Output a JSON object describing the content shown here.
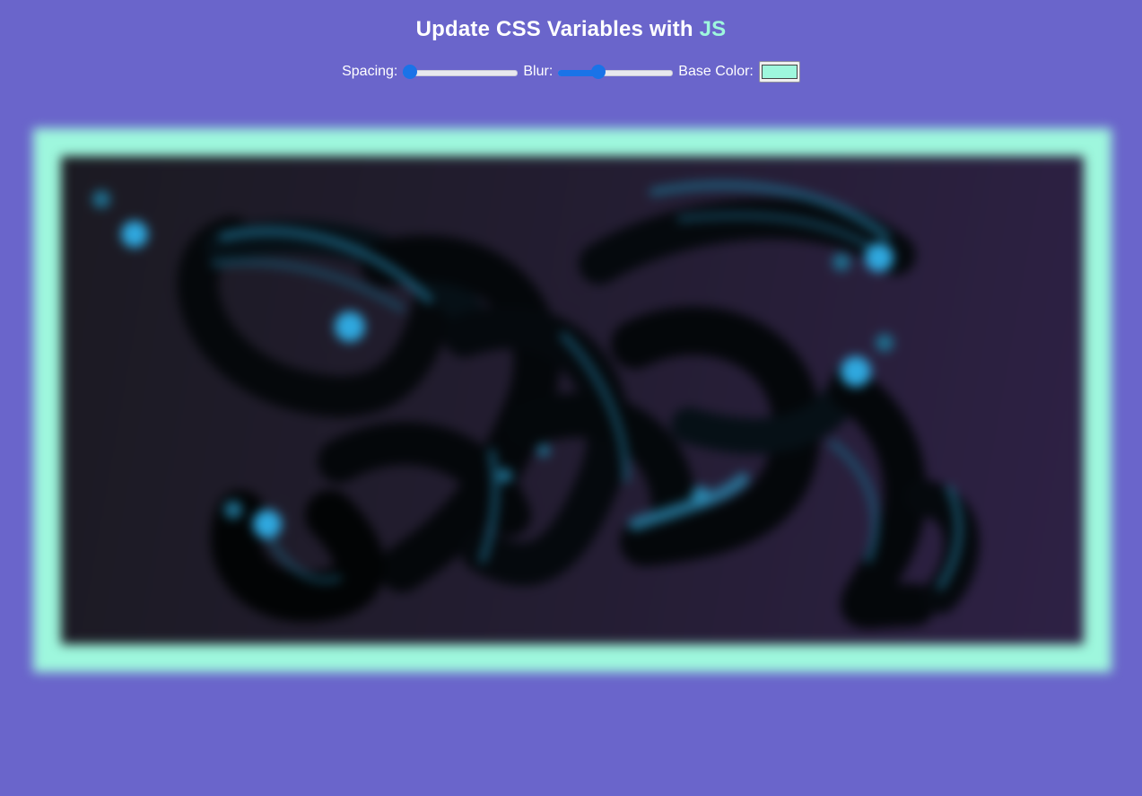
{
  "title": {
    "prefix": "Update CSS Variables with ",
    "highlight": "JS"
  },
  "controls": {
    "spacing_label": "Spacing:",
    "spacing_value": 0,
    "blur_label": "Blur:",
    "blur_value": 0.33,
    "base_color_label": "Base Color:",
    "base_color": "#9ef7dd"
  },
  "colors": {
    "background": "#6a65cb",
    "accent": "#9ef7dd",
    "slider": "#1a73e8"
  }
}
